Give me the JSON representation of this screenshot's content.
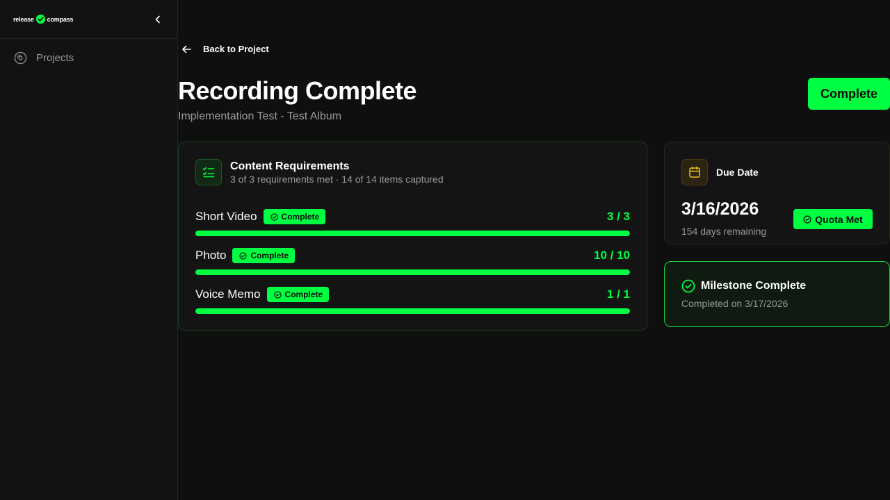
{
  "sidebar": {
    "logo_left": "release",
    "logo_right": "compass",
    "nav": [
      {
        "label": "Projects"
      }
    ]
  },
  "header": {
    "back_label": "Back to Project",
    "title": "Recording Complete",
    "subtitle": "Implementation Test - Test Album",
    "status_button": "Complete"
  },
  "requirements": {
    "title": "Content Requirements",
    "summary": "3 of 3 requirements met · 14 of 14 items captured",
    "items": [
      {
        "name": "Short Video",
        "badge": "Complete",
        "count": "3 / 3",
        "progress": 1.0
      },
      {
        "name": "Photo",
        "badge": "Complete",
        "count": "10 / 10",
        "progress": 1.0
      },
      {
        "name": "Voice Memo",
        "badge": "Complete",
        "count": "1 / 1",
        "progress": 1.0
      }
    ]
  },
  "due": {
    "label": "Due Date",
    "date": "3/16/2026",
    "remaining": "154 days remaining",
    "badge": "Quota Met"
  },
  "milestone": {
    "title": "Milestone Complete",
    "completed_on": "Completed on 3/17/2026"
  },
  "colors": {
    "accent": "#00ff41",
    "background": "#0f0f0f",
    "card": "#141414",
    "due_icon": "#e8c12a"
  },
  "icons": {
    "logo": "compass-check-icon",
    "collapse": "chevron-left-icon",
    "projects": "disc-icon",
    "back": "arrow-left-icon",
    "requirements": "list-checks-icon",
    "badge": "check-circle-icon",
    "due": "calendar-icon",
    "milestone": "check-circle-icon"
  }
}
